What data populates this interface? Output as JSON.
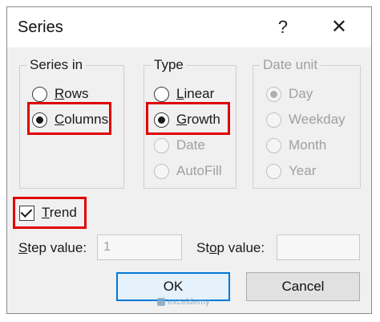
{
  "dialog": {
    "title": "Series",
    "help": "?",
    "close": "✕"
  },
  "series_in": {
    "label": "Series in",
    "options": [
      {
        "pre": "",
        "accel": "R",
        "post": "ows",
        "checked": false
      },
      {
        "pre": "",
        "accel": "C",
        "post": "olumns",
        "checked": true
      }
    ]
  },
  "type": {
    "label": "Type",
    "options": [
      {
        "pre": "",
        "accel": "L",
        "post": "inear",
        "checked": false,
        "enabled": true
      },
      {
        "pre": "",
        "accel": "G",
        "post": "rowth",
        "checked": true,
        "enabled": true
      },
      {
        "pre": "Date",
        "accel": "",
        "post": "",
        "checked": false,
        "enabled": false
      },
      {
        "pre": "AutoFill",
        "accel": "",
        "post": "",
        "checked": false,
        "enabled": false
      }
    ]
  },
  "date_unit": {
    "label": "Date unit",
    "options": [
      {
        "label": "Day",
        "checked": true
      },
      {
        "label": "Weekday",
        "checked": false
      },
      {
        "label": "Month",
        "checked": false
      },
      {
        "label": "Year",
        "checked": false
      }
    ]
  },
  "trend": {
    "accel": "T",
    "post": "rend",
    "checked": true
  },
  "step": {
    "pre": "",
    "accel": "S",
    "post": "tep value:",
    "value": "1"
  },
  "stop": {
    "pre": "St",
    "accel": "o",
    "post": "p value:",
    "value": ""
  },
  "buttons": {
    "ok": "OK",
    "cancel": "Cancel"
  },
  "watermark": "exceldemy"
}
